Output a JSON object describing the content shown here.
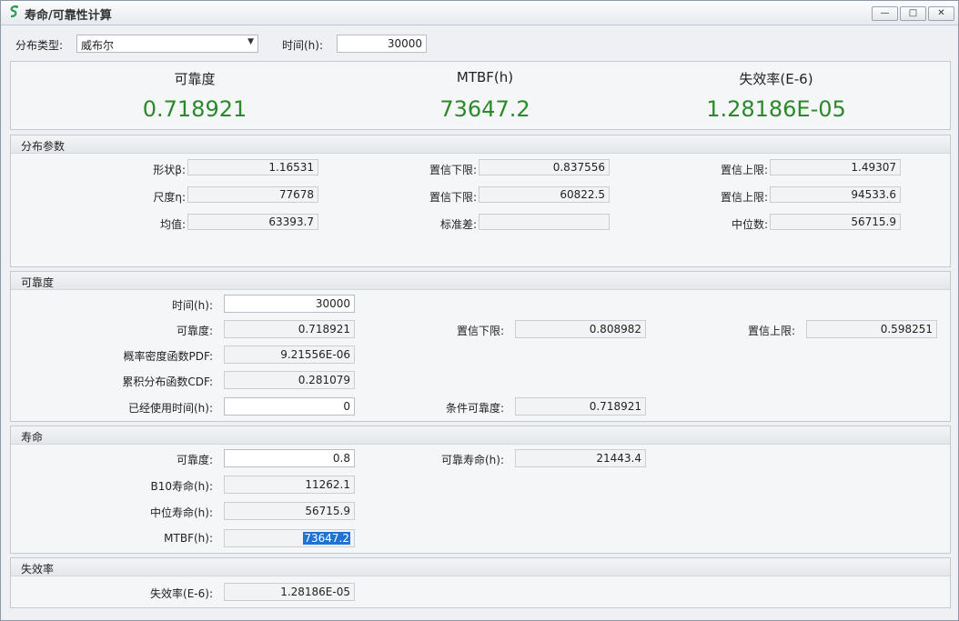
{
  "window": {
    "title": "寿命/可靠性计算",
    "minimize": "—",
    "maximize": "□",
    "close": "✕"
  },
  "top": {
    "dist_label": "分布类型:",
    "dist_value": "威布尔",
    "time_label": "时间(h):",
    "time_value": "30000"
  },
  "summary": {
    "reliability_label": "可靠度",
    "reliability_value": "0.718921",
    "mtbf_label": "MTBF(h)",
    "mtbf_value": "73647.2",
    "failure_label": "失效率(E-6)",
    "failure_value": "1.28186E-05",
    "value_color": "#2a8a2a"
  },
  "params": {
    "title": "分布参数",
    "shape_label": "形状β:",
    "shape_value": "1.16531",
    "shape_lower_label": "置信下限:",
    "shape_lower_value": "0.837556",
    "shape_upper_label": "置信上限:",
    "shape_upper_value": "1.49307",
    "scale_label": "尺度η:",
    "scale_value": "77678",
    "scale_lower_label": "置信下限:",
    "scale_lower_value": "60822.5",
    "scale_upper_label": "置信上限:",
    "scale_upper_value": "94533.6",
    "mean_label": "均值:",
    "mean_value": "63393.7",
    "std_label": "标准差:",
    "std_value": "",
    "median_label": "中位数:",
    "median_value": "56715.9"
  },
  "reliability": {
    "title": "可靠度",
    "time_label": "时间(h):",
    "time_value": "30000",
    "rel_label": "可靠度:",
    "rel_value": "0.718921",
    "lower_label": "置信下限:",
    "lower_value": "0.808982",
    "upper_label": "置信上限:",
    "upper_value": "0.598251",
    "pdf_label": "概率密度函数PDF:",
    "pdf_value": "9.21556E-06",
    "cdf_label": "累积分布函数CDF:",
    "cdf_value": "0.281079",
    "used_label": "已经使用时间(h):",
    "used_value": "0",
    "cond_label": "条件可靠度:",
    "cond_value": "0.718921"
  },
  "life": {
    "title": "寿命",
    "rel_label": "可靠度:",
    "rel_value": "0.8",
    "rel_life_label": "可靠寿命(h):",
    "rel_life_value": "21443.4",
    "b10_label": "B10寿命(h):",
    "b10_value": "11262.1",
    "median_label": "中位寿命(h):",
    "median_value": "56715.9",
    "mtbf_label": "MTBF(h):",
    "mtbf_value": "73647.2"
  },
  "failure": {
    "title": "失效率",
    "rate_label": "失效率(E-6):",
    "rate_value": "1.28186E-05"
  }
}
